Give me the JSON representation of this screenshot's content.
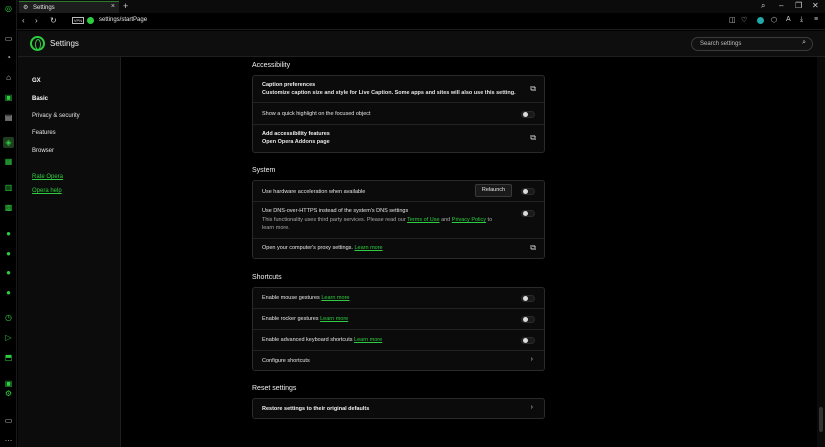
{
  "tab": {
    "title": "Settings",
    "close": "×",
    "new_tab": "+"
  },
  "window": {
    "minimize": "–",
    "restore": "❐",
    "close": "✕",
    "search": "⌕"
  },
  "address_bar": {
    "vpn": "VPN",
    "url": "settings/startPage"
  },
  "header": {
    "title": "Settings",
    "search_placeholder": "Search settings"
  },
  "nav": {
    "items": [
      "GX",
      "Basic",
      "Privacy & security",
      "Features",
      "Browser"
    ],
    "active": "Basic",
    "links": [
      "Rate Opera",
      "Opera help"
    ]
  },
  "accessibility": {
    "title": "Accessibility",
    "caption_title": "Caption preferences",
    "caption_sub": "Customize caption size and style for Live Caption. Some apps and sites will also use this setting.",
    "highlight": "Show a quick highlight on the focused object",
    "add_title": "Add accessibility features",
    "add_sub": "Open Opera Addons page"
  },
  "system": {
    "title": "System",
    "hw_accel": "Use hardware acceleration when available",
    "relaunch": "Relaunch",
    "dns_title": "Use DNS-over-HTTPS instead of the system's DNS settings",
    "dns_sub_1": "This functionality uses third party services. Please read our",
    "dns_terms": "Terms of Use",
    "dns_and": "and",
    "dns_privacy": "Privacy Policy",
    "dns_to": "to",
    "dns_learn": "learn more.",
    "proxy": "Open your computer's proxy settings.",
    "proxy_learn": "Learn more"
  },
  "shortcuts": {
    "title": "Shortcuts",
    "mouse": "Enable mouse gestures",
    "rocker": "Enable rocker gestures",
    "keyboard": "Enable advanced keyboard shortcuts",
    "learn_more": "Learn more",
    "configure": "Configure shortcuts"
  },
  "reset": {
    "title": "Reset settings",
    "restore": "Restore settings to their original defaults"
  },
  "colors": {
    "accent": "#2ecc40",
    "background": "#000000",
    "card": "#0b0b0b"
  }
}
